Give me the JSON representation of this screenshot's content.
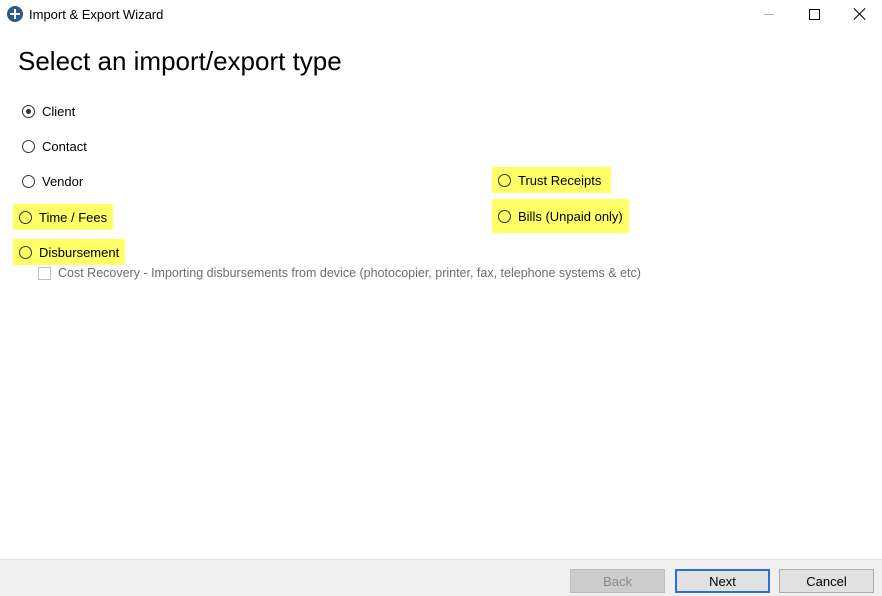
{
  "window": {
    "title": "Import & Export Wizard",
    "icon": "scales-logo-icon"
  },
  "page": {
    "heading": "Select an import/export type"
  },
  "options": {
    "client": {
      "label": "Client",
      "selected": true,
      "highlighted": false
    },
    "contact": {
      "label": "Contact",
      "selected": false,
      "highlighted": false
    },
    "vendor": {
      "label": "Vendor",
      "selected": false,
      "highlighted": false
    },
    "time_fees": {
      "label": "Time / Fees",
      "selected": false,
      "highlighted": true
    },
    "disbursement": {
      "label": "Disbursement",
      "selected": false,
      "highlighted": true
    },
    "trust_receipts": {
      "label": "Trust Receipts",
      "selected": false,
      "highlighted": true
    },
    "bills": {
      "label": "Bills (Unpaid only)",
      "selected": false,
      "highlighted": true
    }
  },
  "cost_recovery": {
    "label": "Cost Recovery - Importing disbursements from device (photocopier,  printer, fax, telephone systems & etc)",
    "checked": false,
    "enabled": false
  },
  "footer": {
    "back_label": "Back",
    "next_label": "Next",
    "cancel_label": "Cancel"
  },
  "colors": {
    "highlight": "#ffff66",
    "primary_button_border": "#2a6fd6"
  }
}
